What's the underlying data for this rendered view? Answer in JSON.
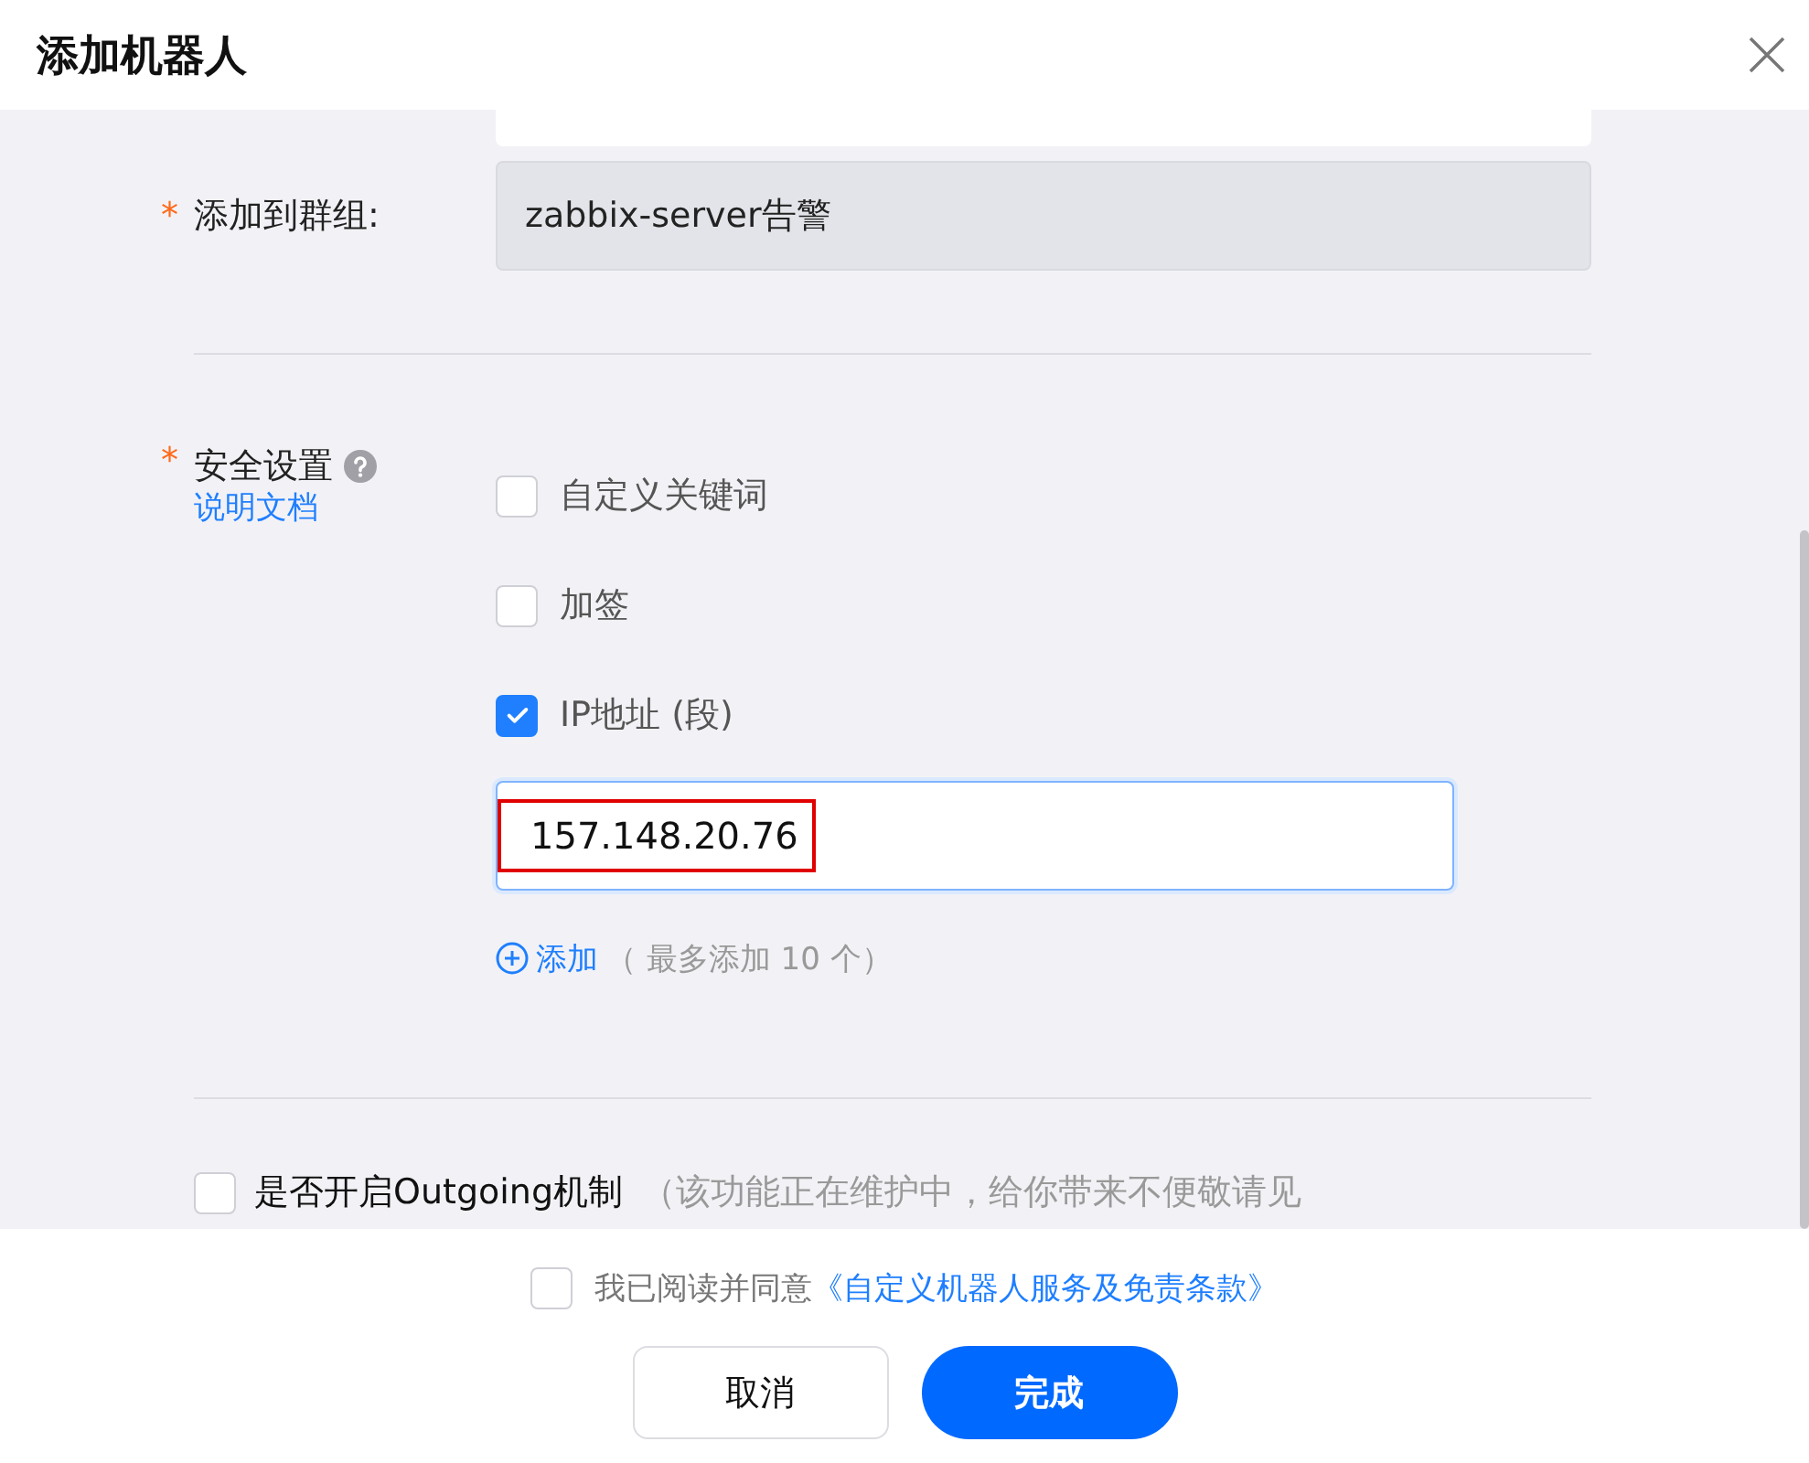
{
  "dialog": {
    "title": "添加机器人"
  },
  "group_field": {
    "marker": "*",
    "label": "添加到群组:",
    "value": "zabbix-server告警",
    "disabled": true
  },
  "security": {
    "marker": "*",
    "label": "安全设置",
    "help_link": "说明文档",
    "options": [
      {
        "label": "自定义关键词",
        "checked": false
      },
      {
        "label": "加签",
        "checked": false
      },
      {
        "label": "IP地址 (段)",
        "checked": true
      }
    ],
    "ip_field": {
      "value": "157.148.20.76",
      "highlighted": true
    },
    "add_link": "添加",
    "add_hint": "（ 最多添加 10 个）"
  },
  "outgoing": {
    "label": "是否开启Outgoing机制",
    "hint": "（该功能正在维护中，给你带来不便敬请见",
    "checked": false
  },
  "agreement": {
    "text": "我已阅读并同意",
    "link": "《自定义机器人服务及免责条款》",
    "checked": false
  },
  "buttons": [
    {
      "label": "取消",
      "kind": "secondary"
    },
    {
      "label": "完成",
      "kind": "primary"
    }
  ]
}
